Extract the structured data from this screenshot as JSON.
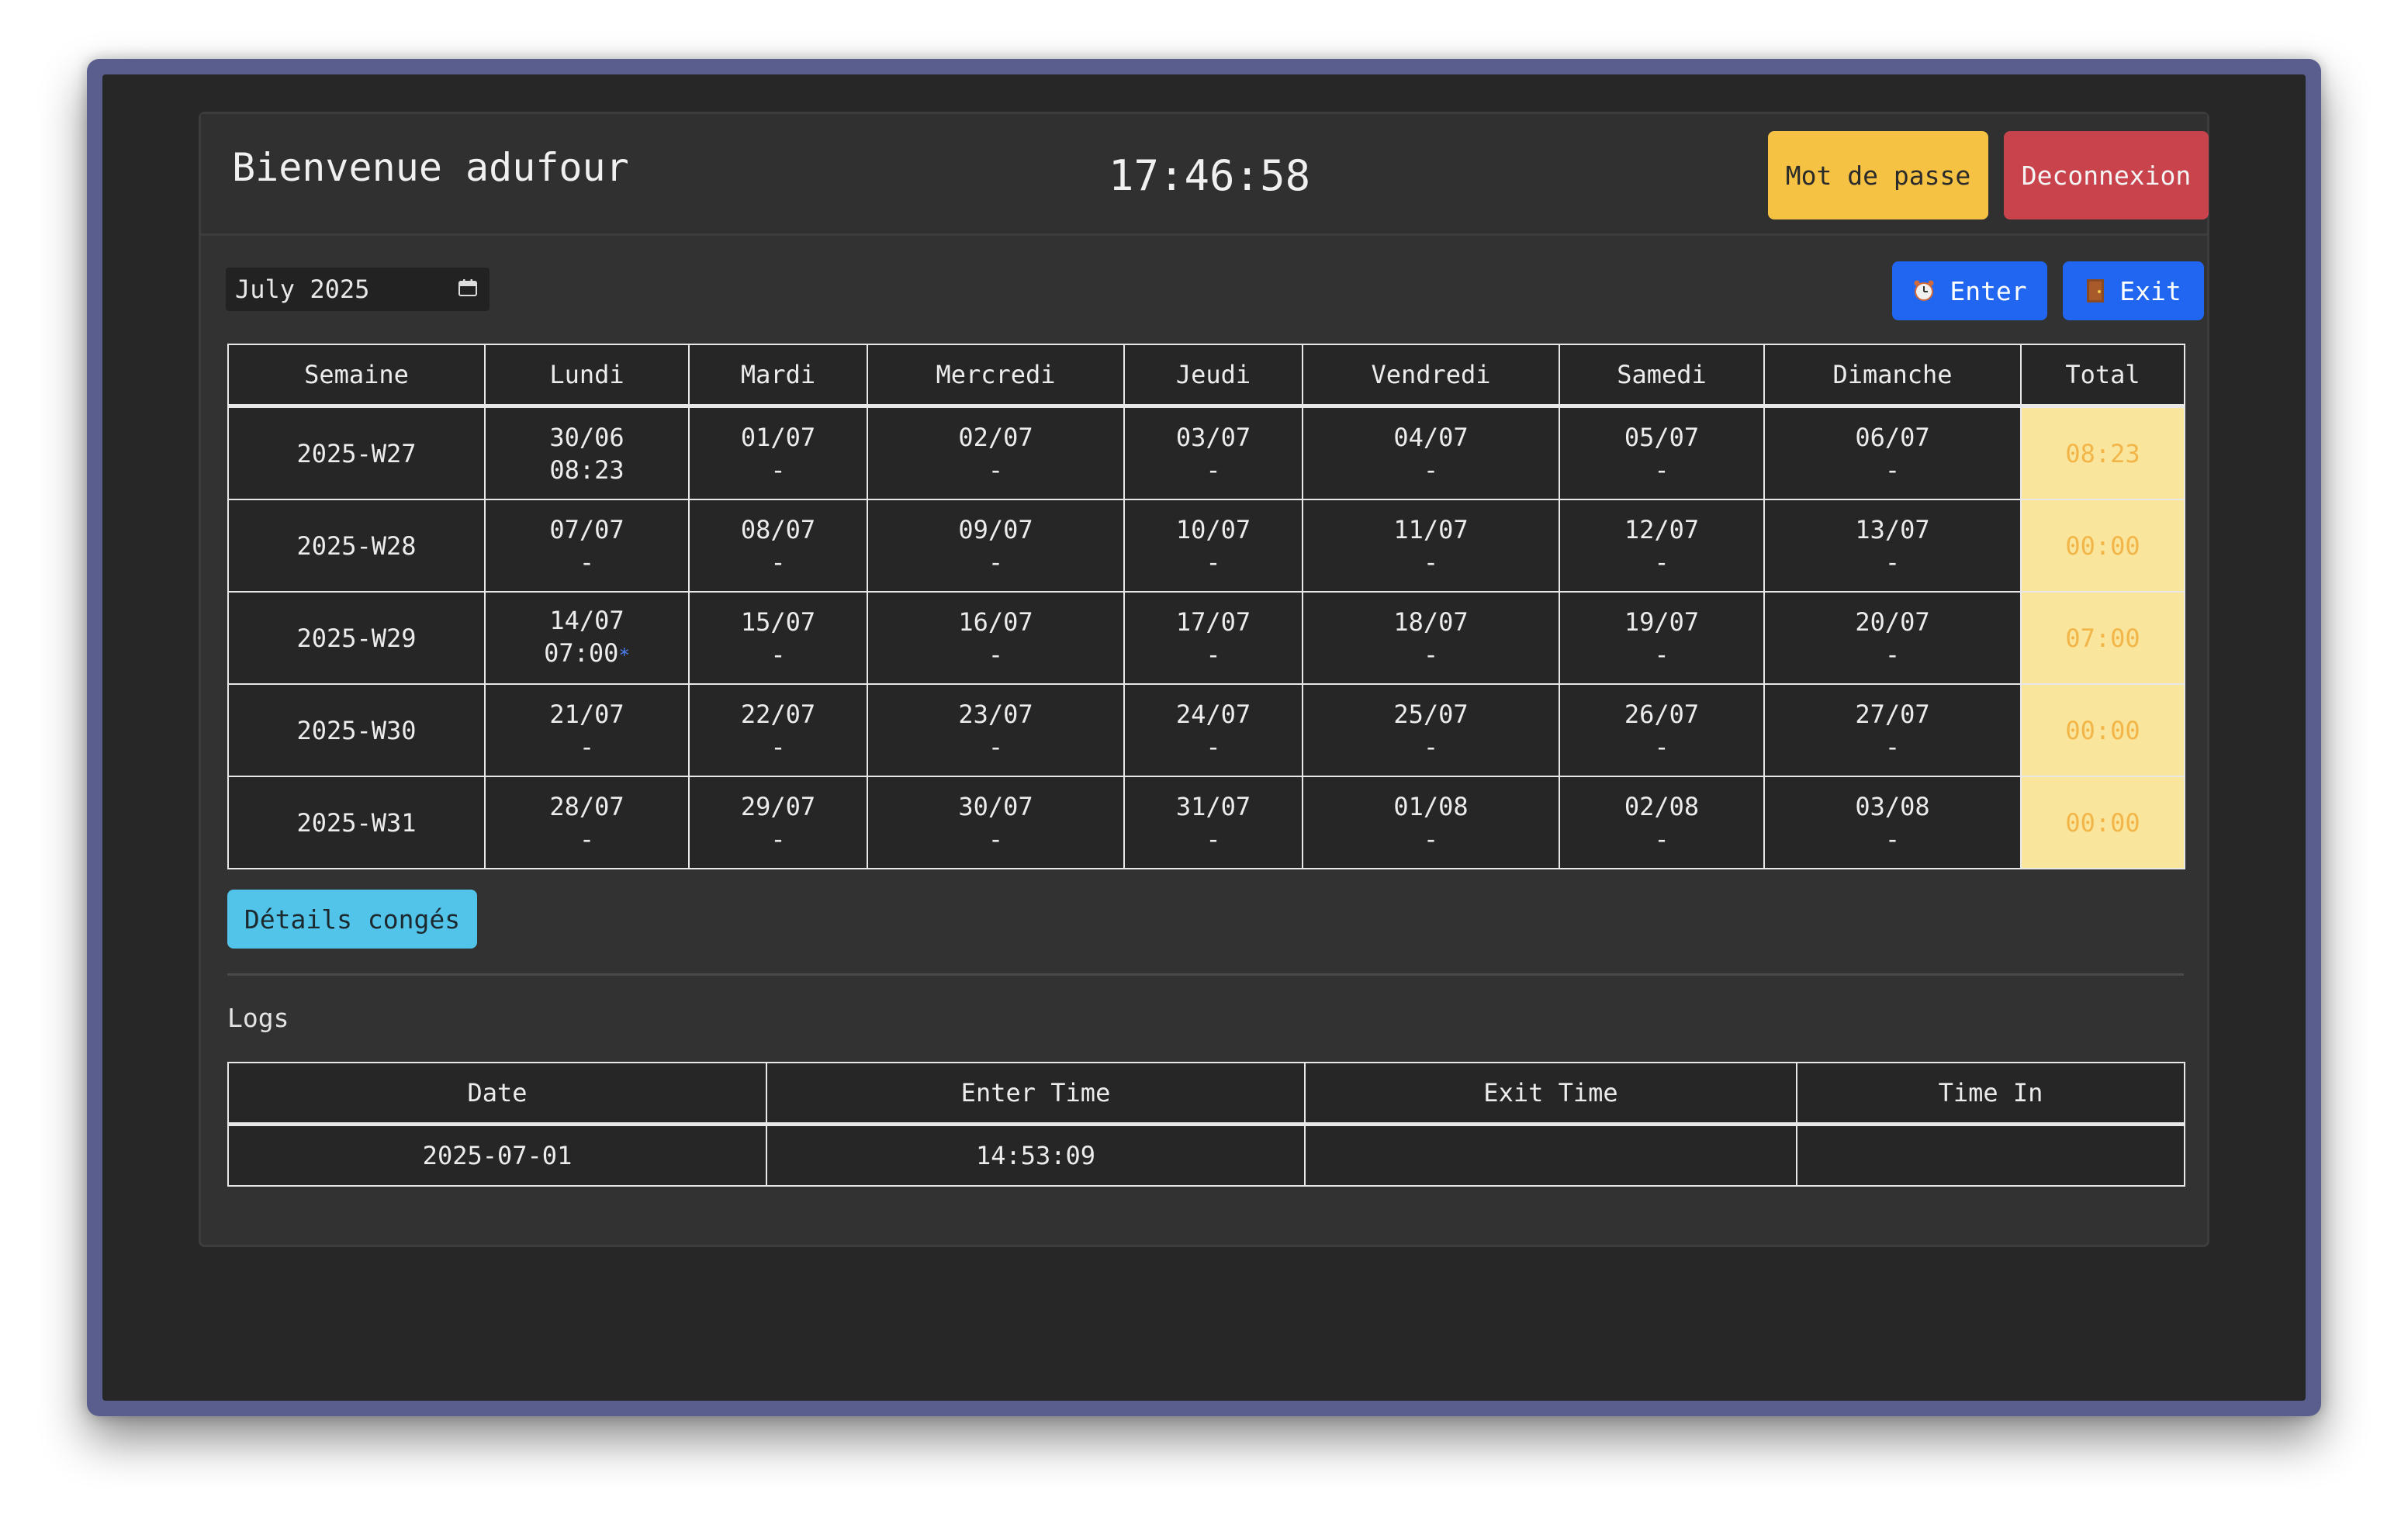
{
  "header": {
    "welcome": "Bienvenue adufour",
    "clock": "17:46:58",
    "password_label": "Mot de passe",
    "logout_label": "Deconnexion"
  },
  "controls": {
    "month_value": "July 2025",
    "enter_label": "Enter",
    "exit_label": "Exit",
    "details_label": "Détails congés"
  },
  "calendar": {
    "headers": [
      "Semaine",
      "Lundi",
      "Mardi",
      "Mercredi",
      "Jeudi",
      "Vendredi",
      "Samedi",
      "Dimanche",
      "Total"
    ],
    "rows": [
      {
        "week": "2025-W27",
        "days": [
          {
            "date": "30/06",
            "time": "08:23"
          },
          {
            "date": "01/07",
            "time": "-"
          },
          {
            "date": "02/07",
            "time": "-"
          },
          {
            "date": "03/07",
            "time": "-"
          },
          {
            "date": "04/07",
            "time": "-"
          },
          {
            "date": "05/07",
            "time": "-"
          },
          {
            "date": "06/07",
            "time": "-"
          }
        ],
        "total": "08:23"
      },
      {
        "week": "2025-W28",
        "days": [
          {
            "date": "07/07",
            "time": "-"
          },
          {
            "date": "08/07",
            "time": "-"
          },
          {
            "date": "09/07",
            "time": "-"
          },
          {
            "date": "10/07",
            "time": "-"
          },
          {
            "date": "11/07",
            "time": "-"
          },
          {
            "date": "12/07",
            "time": "-"
          },
          {
            "date": "13/07",
            "time": "-"
          }
        ],
        "total": "00:00"
      },
      {
        "week": "2025-W29",
        "days": [
          {
            "date": "14/07",
            "time": "07:00",
            "mark": "*"
          },
          {
            "date": "15/07",
            "time": "-"
          },
          {
            "date": "16/07",
            "time": "-"
          },
          {
            "date": "17/07",
            "time": "-"
          },
          {
            "date": "18/07",
            "time": "-"
          },
          {
            "date": "19/07",
            "time": "-"
          },
          {
            "date": "20/07",
            "time": "-"
          }
        ],
        "total": "07:00"
      },
      {
        "week": "2025-W30",
        "days": [
          {
            "date": "21/07",
            "time": "-"
          },
          {
            "date": "22/07",
            "time": "-"
          },
          {
            "date": "23/07",
            "time": "-"
          },
          {
            "date": "24/07",
            "time": "-"
          },
          {
            "date": "25/07",
            "time": "-"
          },
          {
            "date": "26/07",
            "time": "-"
          },
          {
            "date": "27/07",
            "time": "-"
          }
        ],
        "total": "00:00"
      },
      {
        "week": "2025-W31",
        "days": [
          {
            "date": "28/07",
            "time": "-"
          },
          {
            "date": "29/07",
            "time": "-"
          },
          {
            "date": "30/07",
            "time": "-"
          },
          {
            "date": "31/07",
            "time": "-"
          },
          {
            "date": "01/08",
            "time": "-"
          },
          {
            "date": "02/08",
            "time": "-"
          },
          {
            "date": "03/08",
            "time": "-"
          }
        ],
        "total": "00:00"
      }
    ]
  },
  "logs": {
    "title": "Logs",
    "headers": [
      "Date",
      "Enter Time",
      "Exit Time",
      "Time In"
    ],
    "rows": [
      [
        "2025-07-01",
        "14:53:09",
        "",
        ""
      ]
    ]
  },
  "icons": {
    "enter": "alarm-clock-icon",
    "exit": "door-icon",
    "month": "calendar-icon"
  }
}
